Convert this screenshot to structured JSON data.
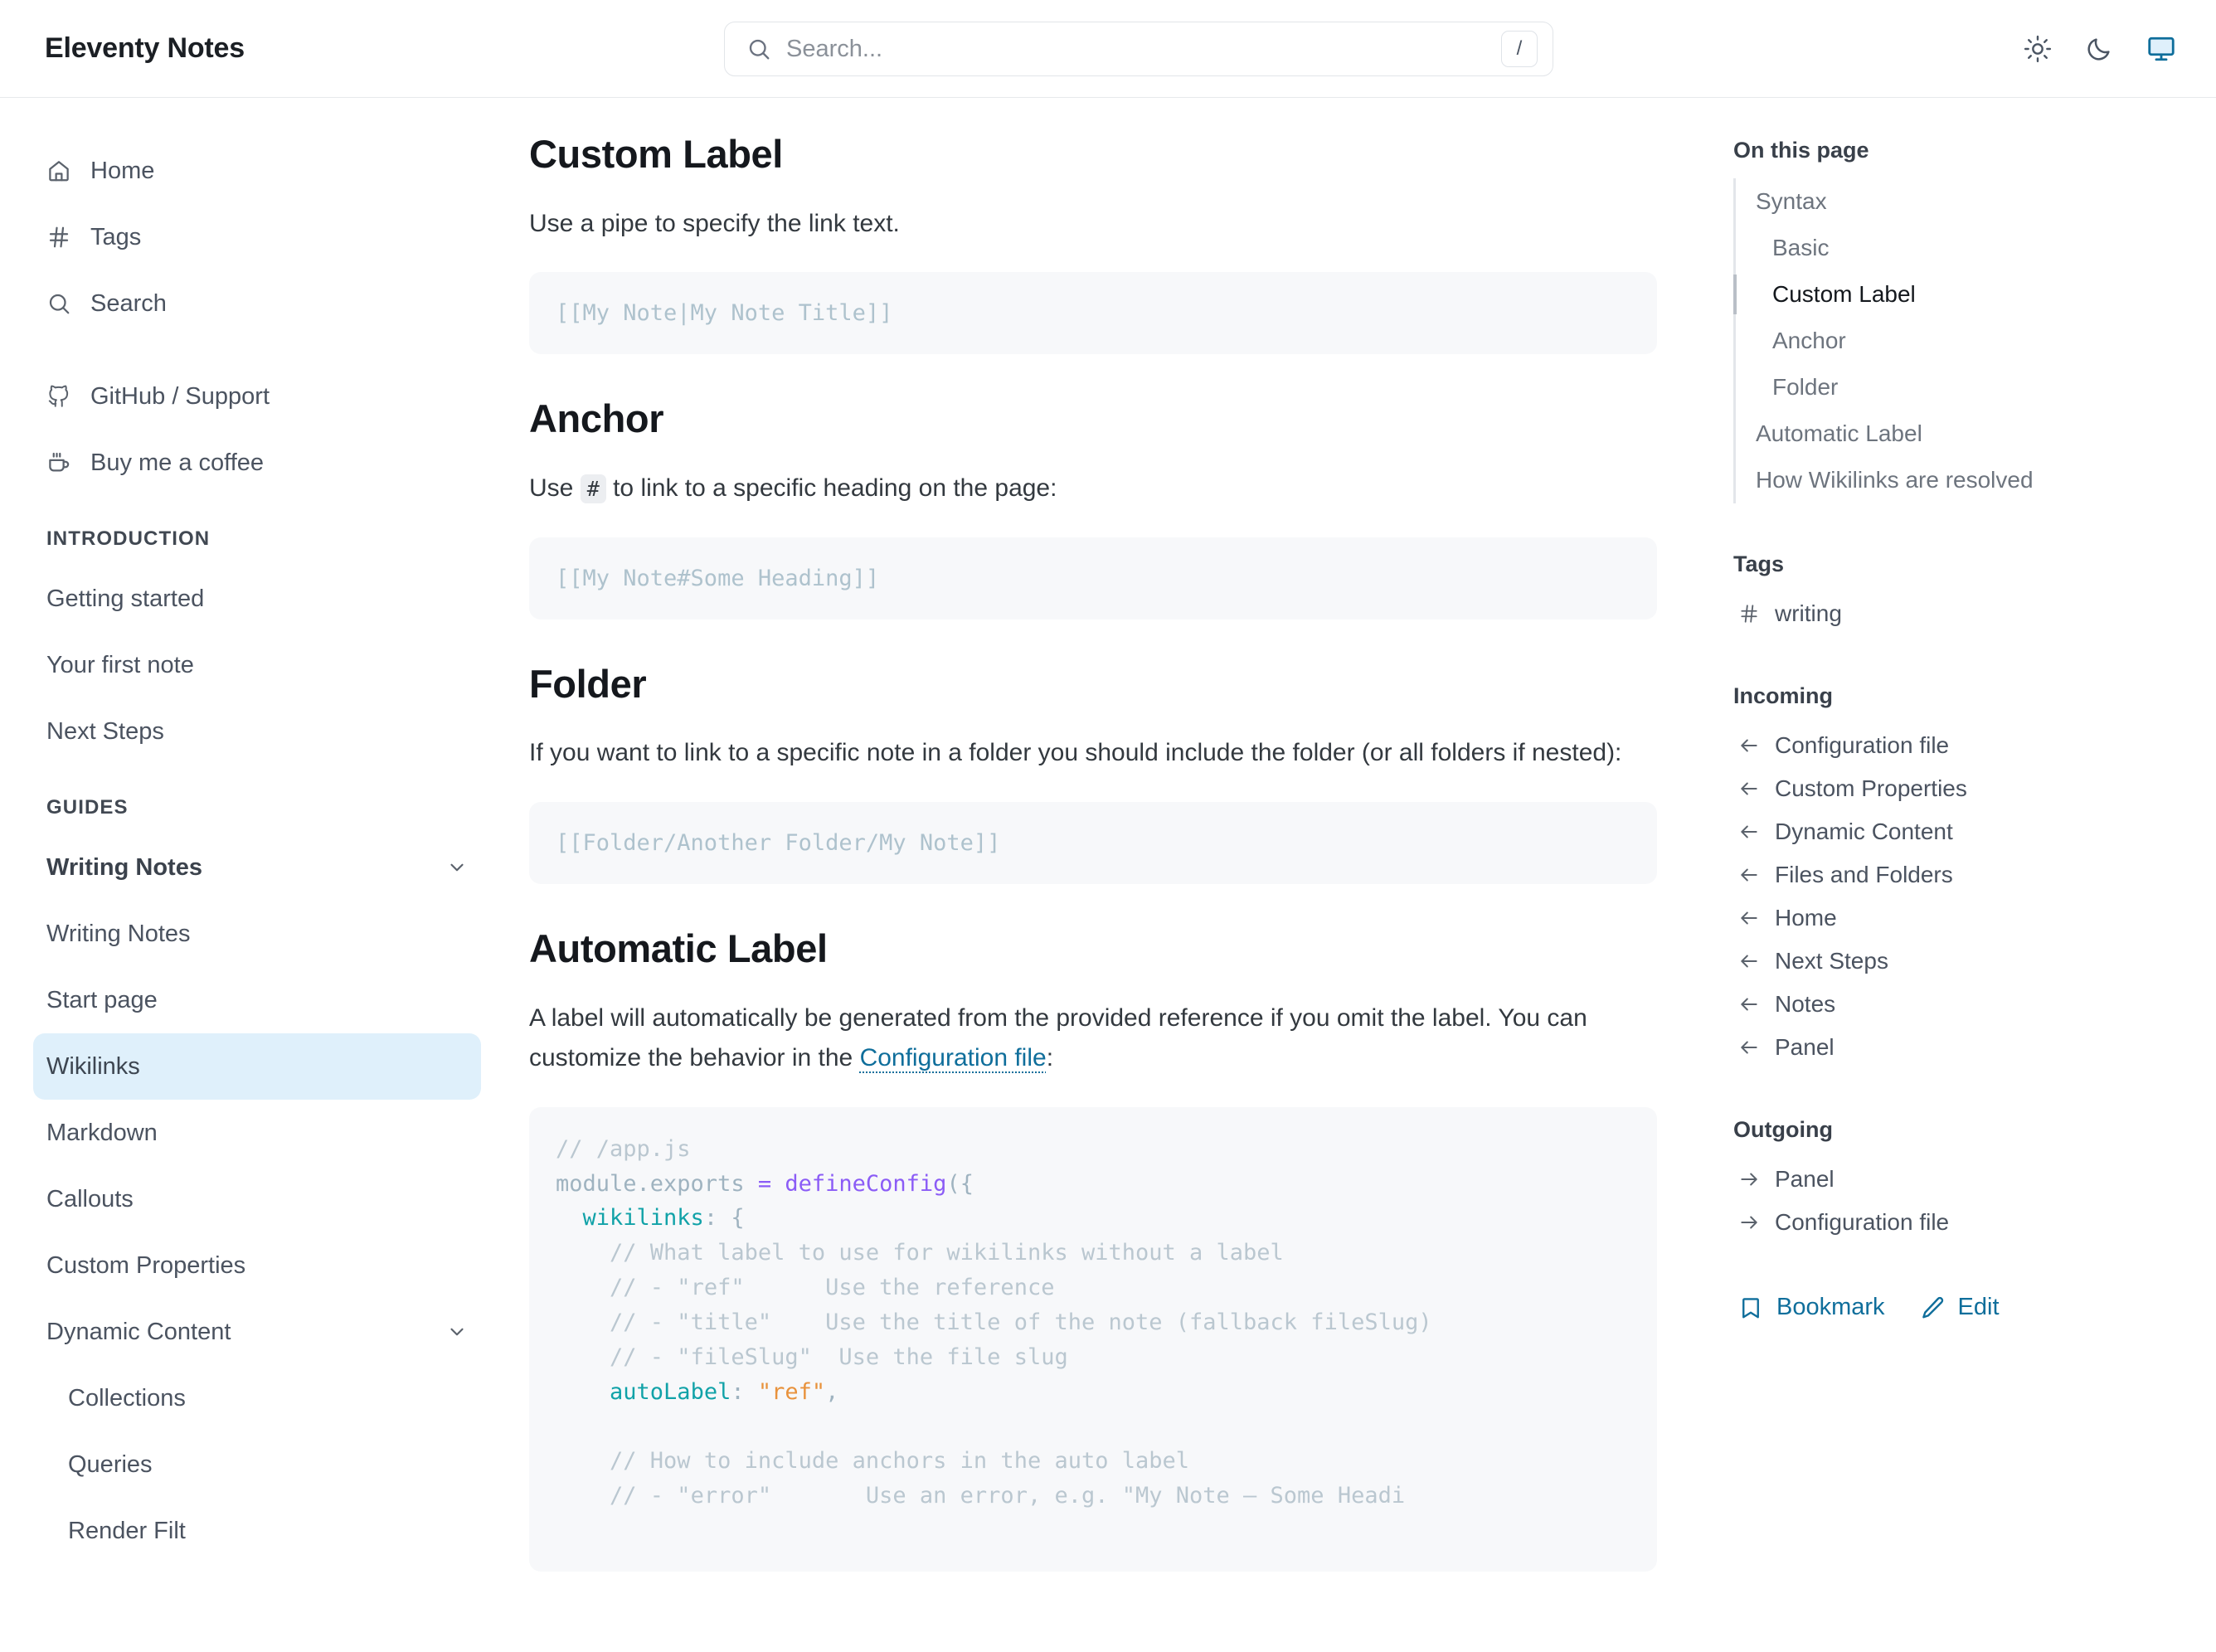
{
  "header": {
    "brand": "Eleventy Notes",
    "search_placeholder": "Search...",
    "search_value": "",
    "search_shortcut": "/",
    "theme_light": "sun-icon",
    "theme_dark": "moon-icon",
    "theme_system": "monitor-icon",
    "active_theme": "system",
    "accent_color": "#0f6e9b"
  },
  "sidebar": {
    "top_links": [
      {
        "label": "Home",
        "icon": "home-icon"
      },
      {
        "label": "Tags",
        "icon": "hash-icon"
      },
      {
        "label": "Search",
        "icon": "search-icon"
      }
    ],
    "external_links": [
      {
        "label": "GitHub / Support",
        "icon": "github-icon"
      },
      {
        "label": "Buy me a coffee",
        "icon": "coffee-icon"
      }
    ],
    "sections": [
      {
        "title": "INTRODUCTION",
        "items": [
          {
            "label": "Getting started"
          },
          {
            "label": "Your first note"
          },
          {
            "label": "Next Steps"
          }
        ]
      },
      {
        "title": "GUIDES",
        "items": [
          {
            "label": "Writing Notes",
            "bold": true,
            "expandable": true
          },
          {
            "label": "Writing Notes"
          },
          {
            "label": "Start page"
          },
          {
            "label": "Wikilinks",
            "active": true
          },
          {
            "label": "Markdown"
          },
          {
            "label": "Callouts"
          },
          {
            "label": "Custom Properties"
          },
          {
            "label": "Dynamic Content",
            "expandable": true
          },
          {
            "label": "Collections",
            "indent": true
          },
          {
            "label": "Queries",
            "indent": true
          },
          {
            "label": "Render Filt",
            "indent": true
          }
        ]
      }
    ],
    "highlight_color": "#dff0fb"
  },
  "content": {
    "sections": [
      {
        "heading": "Custom Label",
        "paragraph": "Use a pipe to specify the link text.",
        "code": "[[My Note|My Note Title]]"
      },
      {
        "heading": "Anchor",
        "paragraph_pre": "Use ",
        "inline_code": "#",
        "paragraph_post": " to link to a specific heading on the page:",
        "code": "[[My Note#Some Heading]]"
      },
      {
        "heading": "Folder",
        "paragraph": "If you want to link to a specific note in a folder you should include the folder (or all folders if nested):",
        "code": "[[Folder/Another Folder/My Note]]"
      },
      {
        "heading": "Automatic Label",
        "paragraph_pre": "A label will automatically be generated from the provided reference if you omit the label. You can customize the behavior in the ",
        "link_text": "Configuration file",
        "paragraph_post": ":"
      }
    ],
    "js_code": {
      "l1_comment": "// /app.js",
      "l2_a": "module.exports",
      "l2_eq": "=",
      "l2_fn": "defineConfig",
      "l2_tail": "({",
      "l3_prop": "wikilinks",
      "l3_tail": ": {",
      "l4": "// What label to use for wikilinks without a label",
      "l5": "// - \"ref\"      Use the reference",
      "l6": "// - \"title\"    Use the title of the note (fallback fileSlug)",
      "l7": "// - \"fileSlug\"  Use the file slug",
      "l8_prop": "autoLabel",
      "l8_colon": ": ",
      "l8_str": "\"ref\"",
      "l8_tail": ",",
      "l9": "// How to include anchors in the auto label",
      "l10": "// - \"error\"       Use an error, e.g. \"My Note — Some Headi"
    }
  },
  "toc": {
    "title": "On this page",
    "items": [
      {
        "label": "Syntax",
        "level": 1
      },
      {
        "label": "Basic",
        "level": 2
      },
      {
        "label": "Custom Label",
        "level": 2,
        "active": true
      },
      {
        "label": "Anchor",
        "level": 2
      },
      {
        "label": "Folder",
        "level": 2
      },
      {
        "label": "Automatic Label",
        "level": 1
      },
      {
        "label": "How Wikilinks are resolved",
        "level": 1
      }
    ],
    "tags_title": "Tags",
    "tags": [
      {
        "label": "writing",
        "icon": "hash-icon"
      }
    ],
    "incoming_title": "Incoming",
    "incoming": [
      {
        "label": "Configuration file"
      },
      {
        "label": "Custom Properties"
      },
      {
        "label": "Dynamic Content"
      },
      {
        "label": "Files and Folders"
      },
      {
        "label": "Home"
      },
      {
        "label": "Next Steps"
      },
      {
        "label": "Notes"
      },
      {
        "label": "Panel"
      }
    ],
    "outgoing_title": "Outgoing",
    "outgoing": [
      {
        "label": "Panel"
      },
      {
        "label": "Configuration file"
      }
    ],
    "actions": [
      {
        "label": "Bookmark",
        "icon": "bookmark-icon"
      },
      {
        "label": "Edit",
        "icon": "pencil-icon"
      }
    ]
  }
}
